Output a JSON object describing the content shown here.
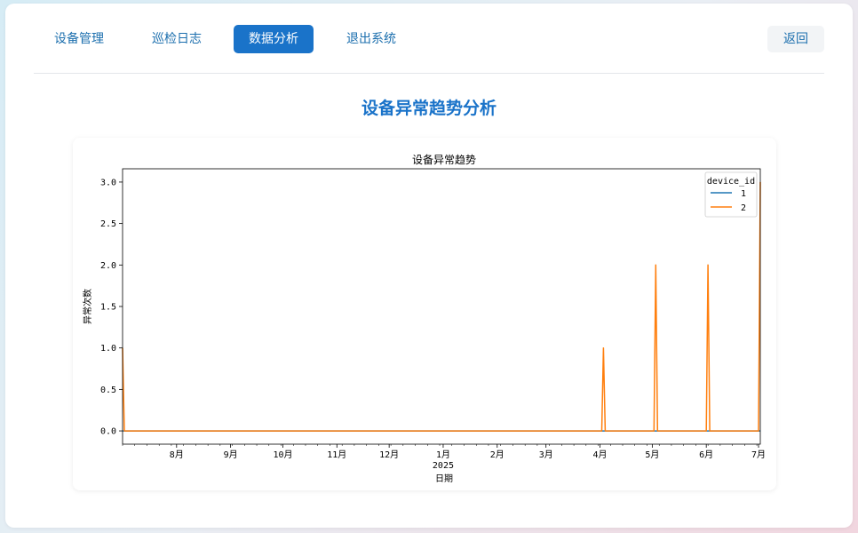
{
  "nav": {
    "items": [
      {
        "label": "设备管理"
      },
      {
        "label": "巡检日志"
      },
      {
        "label": "数据分析"
      },
      {
        "label": "退出系统"
      }
    ],
    "back_label": "返回"
  },
  "page": {
    "title": "设备异常趋势分析"
  },
  "colors": {
    "accent": "#1a73c9",
    "series_1": "#1f77b4",
    "series_2": "#ff7f0e"
  },
  "chart_data": {
    "type": "line",
    "title": "设备异常趋势",
    "xlabel": "日期",
    "ylabel": "异常次数",
    "x_range": [
      "2024-07-01",
      "2025-07-02"
    ],
    "ylim": [
      -0.16,
      3.16
    ],
    "yticks": [
      "0.0",
      "0.5",
      "1.0",
      "1.5",
      "2.0",
      "2.5",
      "3.0"
    ],
    "xticks": [
      {
        "date": "2024-08-01",
        "label": "8月"
      },
      {
        "date": "2024-09-01",
        "label": "9月"
      },
      {
        "date": "2024-10-01",
        "label": "10月"
      },
      {
        "date": "2024-11-01",
        "label": "11月"
      },
      {
        "date": "2024-12-01",
        "label": "12月"
      },
      {
        "date": "2025-01-01",
        "label": "1月"
      },
      {
        "date": "2025-02-01",
        "label": "2月"
      },
      {
        "date": "2025-03-01",
        "label": "3月"
      },
      {
        "date": "2025-04-01",
        "label": "4月"
      },
      {
        "date": "2025-05-01",
        "label": "5月"
      },
      {
        "date": "2025-06-01",
        "label": "6月"
      },
      {
        "date": "2025-07-01",
        "label": "7月"
      }
    ],
    "year_label": "2025",
    "legend_title": "device_id",
    "legend_position": "top-right",
    "series": [
      {
        "name": "1",
        "color": "#1f77b4",
        "points": [
          [
            "2024-07-01",
            0
          ],
          [
            "2025-07-02",
            0
          ]
        ]
      },
      {
        "name": "2",
        "color": "#ff7f0e",
        "points": [
          [
            "2024-07-01",
            1
          ],
          [
            "2024-07-02",
            0
          ],
          [
            "2025-04-02",
            0
          ],
          [
            "2025-04-03",
            1
          ],
          [
            "2025-04-04",
            0
          ],
          [
            "2025-05-02",
            0
          ],
          [
            "2025-05-03",
            2
          ],
          [
            "2025-05-04",
            0
          ],
          [
            "2025-06-01",
            0
          ],
          [
            "2025-06-02",
            2
          ],
          [
            "2025-06-03",
            0
          ],
          [
            "2025-07-01",
            0
          ],
          [
            "2025-07-02",
            3
          ]
        ]
      }
    ]
  }
}
